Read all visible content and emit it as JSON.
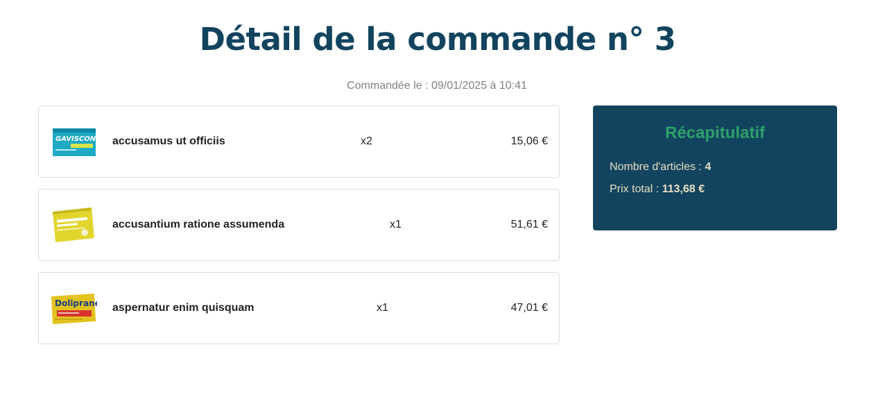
{
  "page": {
    "title": "Détail de la commande n° 3",
    "ordered_on": "Commandée le : 09/01/2025 à 10:41"
  },
  "items": [
    {
      "name": "accusamus ut officiis",
      "qty": "x2",
      "price": "15,06 €",
      "image": "gaviscon-box"
    },
    {
      "name": "accusantium ratione assumenda",
      "qty": "x1",
      "price": "51,61 €",
      "image": "citrate-de-betaine-box"
    },
    {
      "name": "aspernatur enim quisquam",
      "qty": "x1",
      "price": "47,01 €",
      "image": "doliprane-box"
    }
  ],
  "summary": {
    "title": "Récapitulatif",
    "count_label": "Nombre d'articles : ",
    "count_value": "4",
    "total_label": "Prix total : ",
    "total_value": "113,68 €"
  },
  "colors": {
    "primary": "#12445f",
    "accent": "#2ea16a"
  }
}
